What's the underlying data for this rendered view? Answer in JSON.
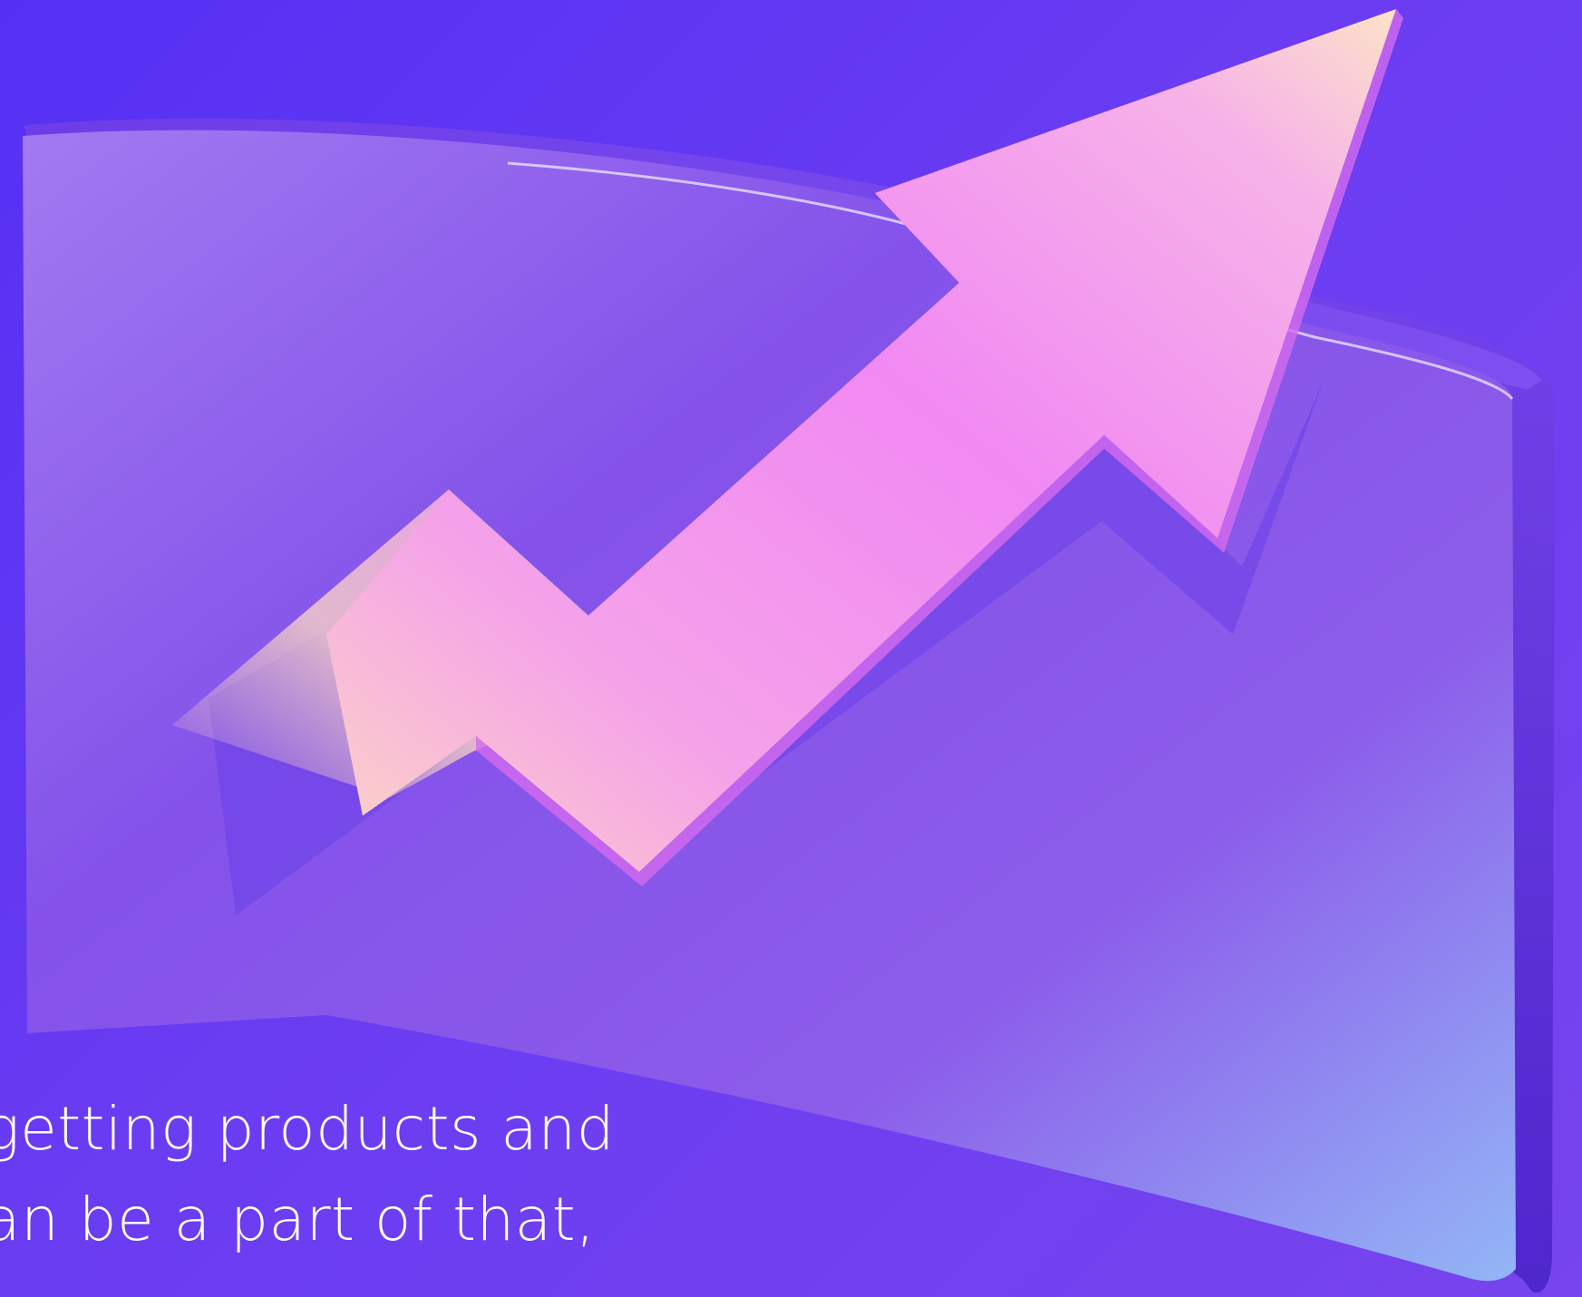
{
  "illustration": {
    "name": "growth-chart-illustration",
    "description_icon": "trending-up-arrow-icon",
    "colors": {
      "background_start": "#5530f4",
      "background_end": "#7744ee",
      "panel_light": "#a27af1",
      "panel_dark": "#6a3ee8",
      "panel_edge": "#4a24c8",
      "arrow_pink": "#f189f3",
      "arrow_peach": "#fcd7c3",
      "arrow_shadow": "#6a3fe8"
    }
  },
  "text_fragment": {
    "lines": [
      "getting products and",
      "an be a part of that,",
      ""
    ],
    "color": "#ffffff"
  }
}
